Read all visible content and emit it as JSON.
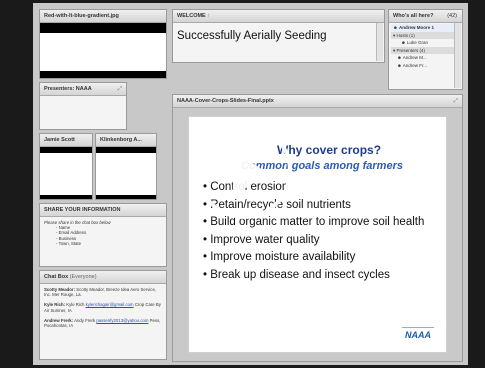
{
  "pods": {
    "image": {
      "title": "Red-with-lt-blue-gradient.jpg"
    },
    "presenters": {
      "title": "Presenters: NAAA"
    },
    "cam_left": {
      "title": "Jamie Scott"
    },
    "cam_right": {
      "title": "Klinkenborg A..."
    },
    "welcome": {
      "title": "WELCOME",
      "text": "Successfully Aerially Seeding"
    },
    "attendees": {
      "title": "Who's all here?",
      "count": "(42)",
      "rows": [
        {
          "label": "Andrew Moore 1"
        },
        {
          "label": "Hosts (1)"
        },
        {
          "label": "Luke Gran"
        },
        {
          "label": "Presenters (4)"
        },
        {
          "label": "Andrew M..."
        },
        {
          "label": "Andrew Fr..."
        }
      ]
    },
    "slides": {
      "title": "NAAA-Cover-Crops-Slides-Final.pptx"
    },
    "share": {
      "title": "SHARE YOUR INFORMATION",
      "intro": "Please share in the chat box below",
      "items": [
        "Name",
        "Email Address",
        "Business",
        "Town, State"
      ]
    },
    "chat": {
      "title": "Chat Box",
      "subtitle": "(Everyone)",
      "messages": [
        {
          "name": "Scotty Meador:",
          "text": "Scotty Meador, Breeze Idea Aero Service, Inc. Mer Rouge, La."
        },
        {
          "name": "Kyle Rich:",
          "text": "Kyle Rich",
          "link": "kylerichagair@gmail.com",
          "after": "Crop Care By Air Sumner, IA"
        },
        {
          "name": "Andrew Frerk:",
          "text": "Andy Frerk",
          "link": "passenfy2013@yahoo.com",
          "after": "Pess, Pocahontas, IA"
        }
      ]
    }
  },
  "slide": {
    "title": "Why cover crops?",
    "subtitle": "Common goals among farmers",
    "bullets": [
      "Control erosion",
      "Retain/recycle soil nutrients",
      "Build organic matter to improve soil health",
      "Improve water quality",
      "Improve moisture availability",
      "Break up disease and insect cycles"
    ],
    "logo": "NAAA"
  },
  "icons": {
    "play": "play-icon",
    "user": "user-icon",
    "gear": "gear-icon"
  }
}
